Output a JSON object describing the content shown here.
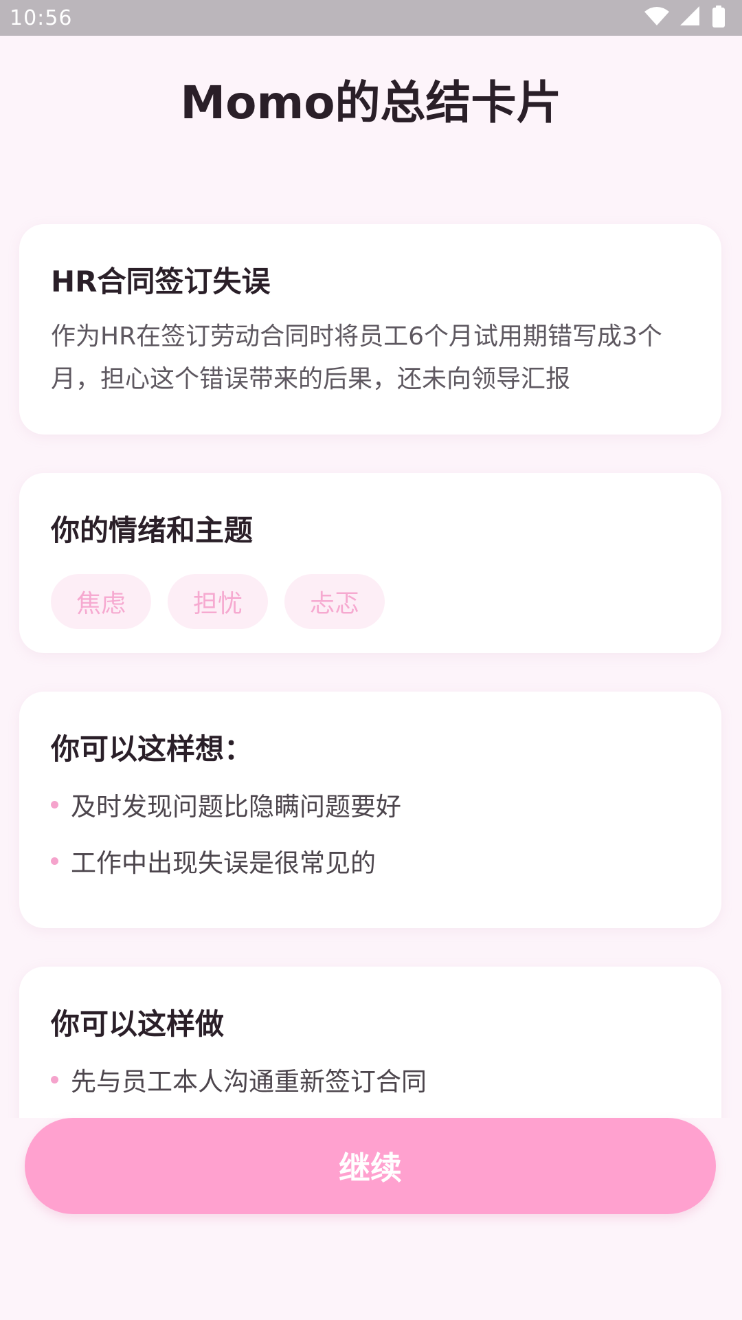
{
  "status_bar": {
    "time": "10:56",
    "icons": [
      "wifi-icon",
      "signal-icon",
      "battery-icon"
    ]
  },
  "page": {
    "title": "Momo的总结卡片"
  },
  "summary_card": {
    "title": "HR合同签订失误",
    "text": "作为HR在签订劳动合同时将员工6个月试用期错写成3个月，担心这个错误带来的后果，还未向领导汇报"
  },
  "emotion_card": {
    "title": "你的情绪和主题",
    "tags": [
      "焦虑",
      "担忧",
      "忐忑"
    ]
  },
  "think_card": {
    "title": "你可以这样想：",
    "items": [
      "及时发现问题比隐瞒问题要好",
      "工作中出现失误是很常见的"
    ]
  },
  "do_card": {
    "title": "你可以这样做",
    "items": [
      "先与员工本人沟通重新签订合同"
    ]
  },
  "actions": {
    "continue_label": "继续"
  },
  "colors": {
    "accent": "#ffa1cf",
    "tag_bg": "#fdeef6",
    "tag_text": "#f6a9d0",
    "background": "#fdf4fa"
  }
}
